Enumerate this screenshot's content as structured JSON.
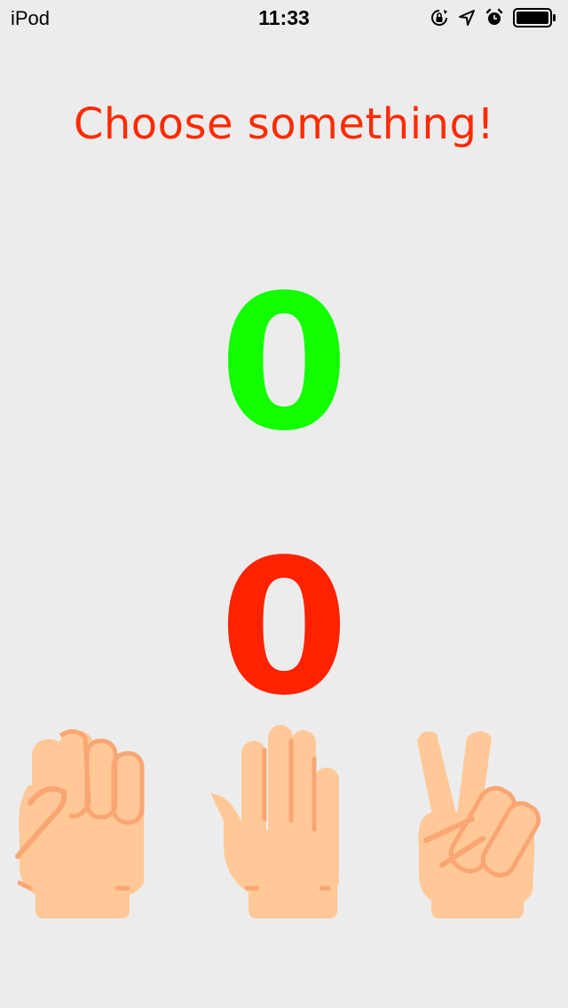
{
  "status_bar": {
    "carrier": "iPod",
    "time": "11:33",
    "icons": [
      "orientation-lock-icon",
      "location-arrow-icon",
      "alarm-icon",
      "battery-icon"
    ]
  },
  "title": "Choose something!",
  "scores": {
    "player": "0",
    "computer": "0"
  },
  "choices": [
    {
      "icon": "rock-fist-icon"
    },
    {
      "icon": "paper-hand-icon"
    },
    {
      "icon": "scissors-hand-icon"
    }
  ],
  "colors": {
    "title": "#ff2a00",
    "player_score": "#11ff00",
    "computer_score": "#ff2200",
    "skin": "#ffc896",
    "skin_line": "#f9a674",
    "background": "#ececec"
  }
}
